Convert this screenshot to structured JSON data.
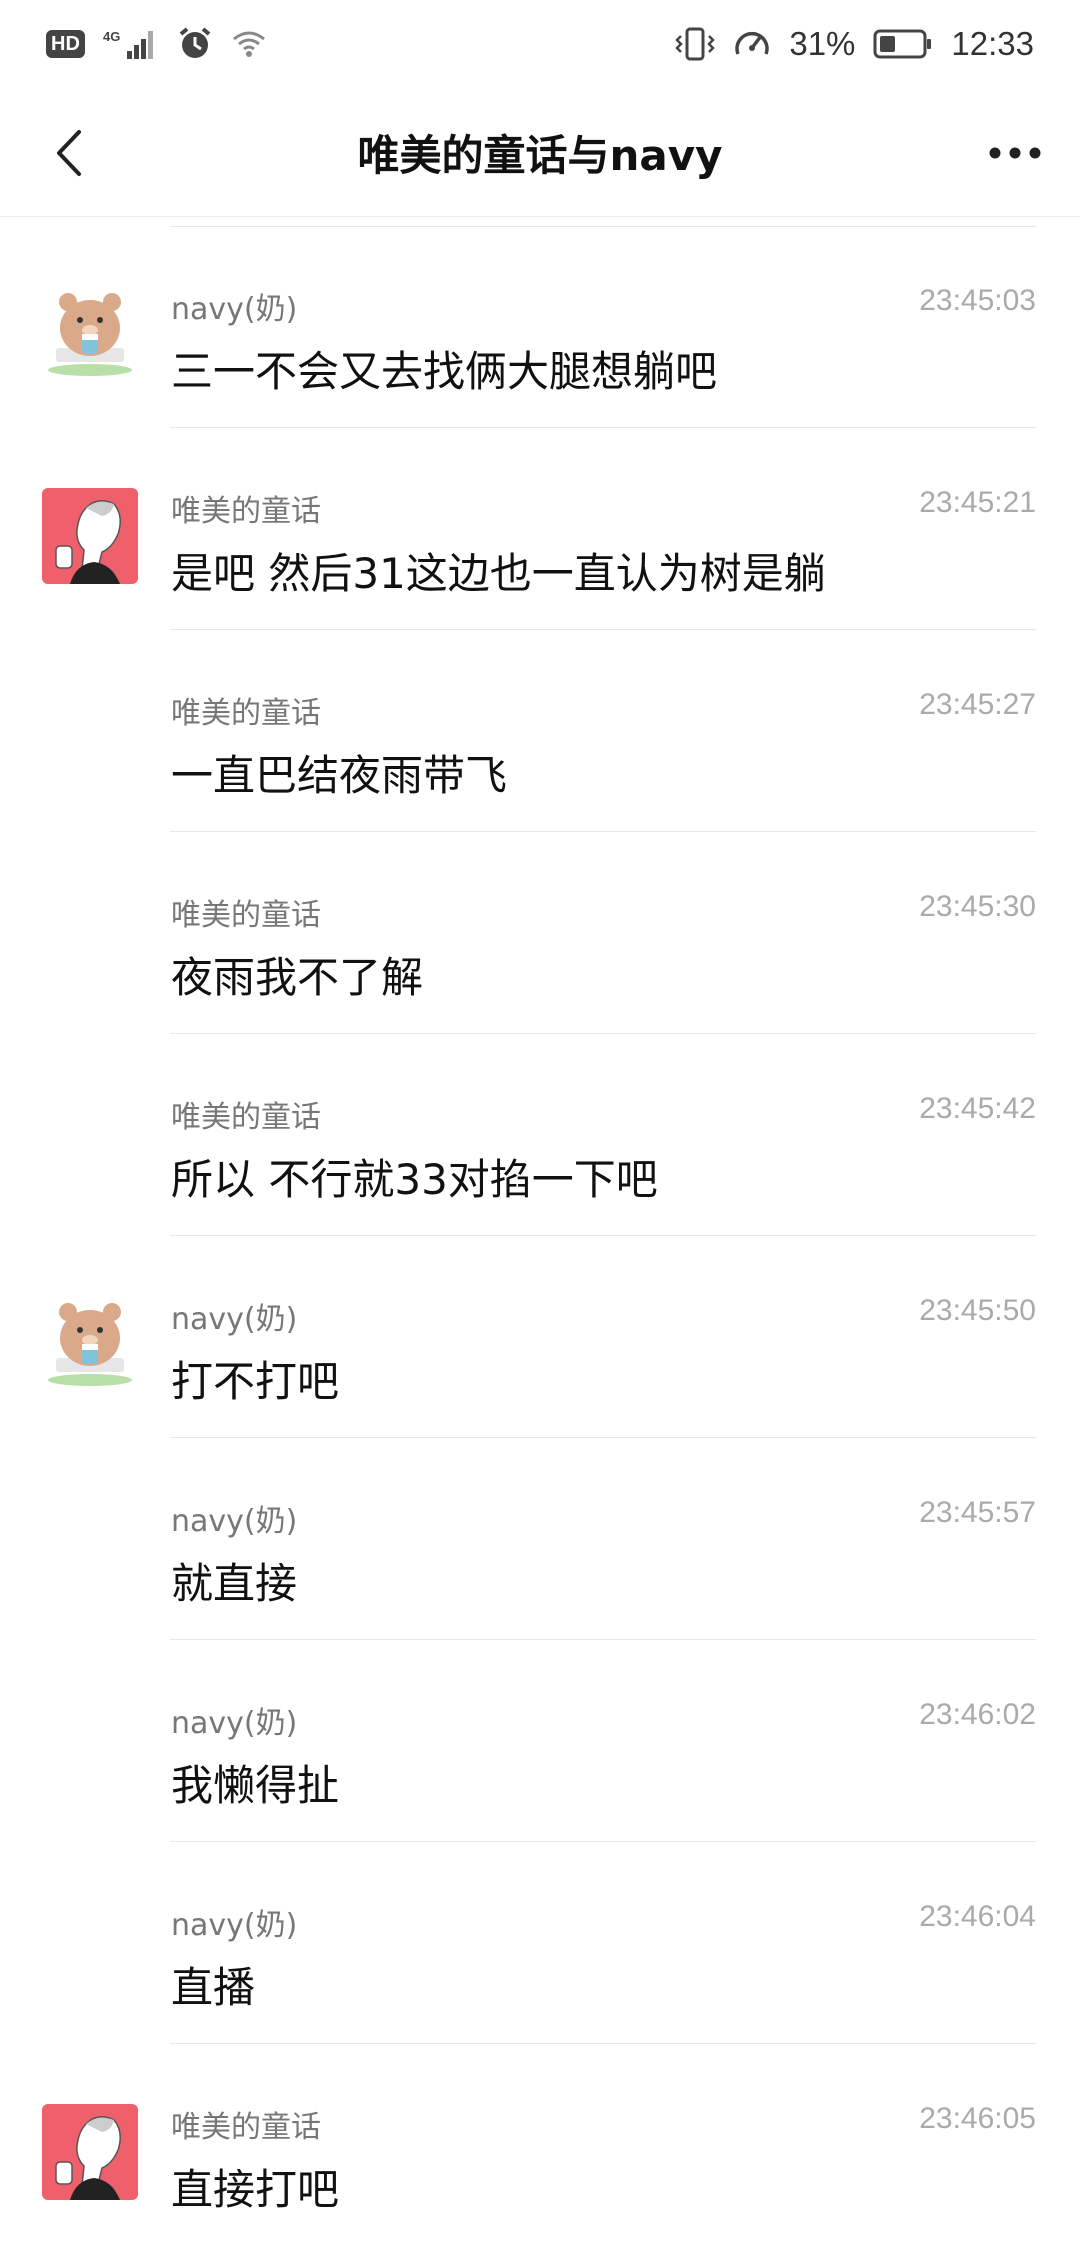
{
  "status_bar": {
    "hd": "HD",
    "network": "4G",
    "battery_percent": "31%",
    "time": "12:33"
  },
  "header": {
    "title": "唯美的童话与navy"
  },
  "messages": [
    {
      "sender": "navy(奶)",
      "time": "23:45:03",
      "text": "三一不会又去找俩大腿想躺吧",
      "avatar": "bear"
    },
    {
      "sender": "唯美的童话",
      "time": "23:45:21",
      "text": "是吧 然后31这边也一直认为树是躺",
      "avatar": "girl"
    },
    {
      "sender": "唯美的童话",
      "time": "23:45:27",
      "text": "一直巴结夜雨带飞",
      "avatar": ""
    },
    {
      "sender": "唯美的童话",
      "time": "23:45:30",
      "text": "夜雨我不了解",
      "avatar": ""
    },
    {
      "sender": "唯美的童话",
      "time": "23:45:42",
      "text": "所以 不行就33对掐一下吧",
      "avatar": ""
    },
    {
      "sender": "navy(奶)",
      "time": "23:45:50",
      "text": "打不打吧",
      "avatar": "bear"
    },
    {
      "sender": "navy(奶)",
      "time": "23:45:57",
      "text": "就直接",
      "avatar": ""
    },
    {
      "sender": "navy(奶)",
      "time": "23:46:02",
      "text": "我懒得扯",
      "avatar": ""
    },
    {
      "sender": "navy(奶)",
      "time": "23:46:04",
      "text": "直播",
      "avatar": ""
    },
    {
      "sender": "唯美的童话",
      "time": "23:46:05",
      "text": "直接打吧",
      "avatar": "girl"
    }
  ],
  "colors": {
    "girl_avatar_bg": "#f0606c",
    "bear_color": "#d9a98a",
    "divider": "#e8e8e8"
  }
}
